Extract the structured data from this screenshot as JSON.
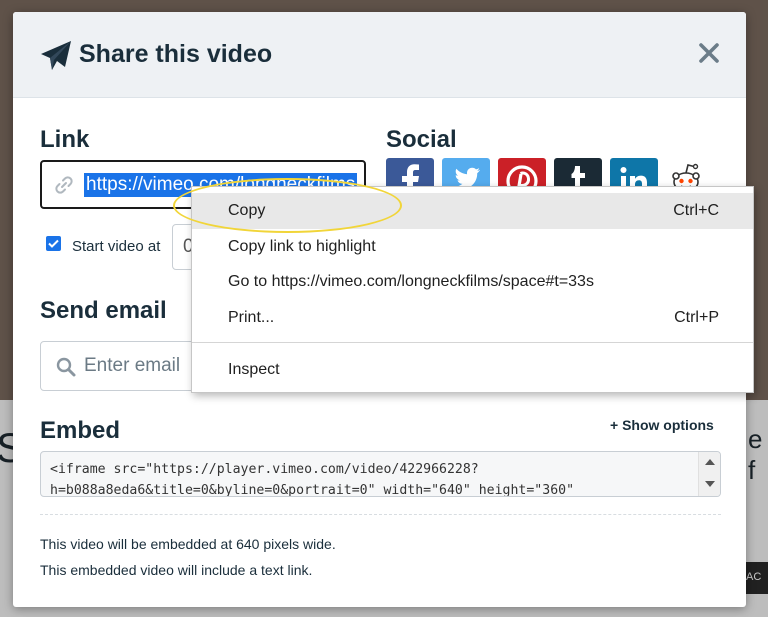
{
  "background": {
    "left_text": "S",
    "right_text": "e f",
    "right_badge": "AC"
  },
  "modal": {
    "title": "Share this video",
    "link": {
      "label": "Link",
      "url": "https://vimeo.com/longneckfilms"
    },
    "start_video": {
      "label": "Start video at",
      "checked": true,
      "value_partial": "0"
    },
    "social": {
      "label": "Social",
      "icons": [
        "facebook-icon",
        "twitter-icon",
        "pinterest-icon",
        "tumblr-icon",
        "linkedin-icon",
        "reddit-icon"
      ]
    },
    "send_email": {
      "label": "Send email",
      "placeholder": "Enter email"
    },
    "embed": {
      "label": "Embed",
      "show_options": "+ Show options",
      "code": "<iframe src=\"https://player.vimeo.com/video/422966228?\nh=b088a8eda6&title=0&byline=0&portrait=0\" width=\"640\" height=\"360\"",
      "note_width": "This video will be embedded at 640 pixels wide.",
      "note_link": "This embedded video will include a text link."
    }
  },
  "context_menu": {
    "items": [
      {
        "label": "Copy",
        "shortcut": "Ctrl+C"
      },
      {
        "label": "Copy link to highlight",
        "shortcut": ""
      },
      {
        "label": "Go to https://vimeo.com/longneckfilms/space#t=33s",
        "shortcut": ""
      },
      {
        "label": "Print...",
        "shortcut": "Ctrl+P"
      },
      {
        "label": "Inspect",
        "shortcut": ""
      }
    ]
  },
  "colors": {
    "facebook": "#3b5998",
    "twitter": "#55acee",
    "pinterest": "#cb2027",
    "tumblr": "#1b2a35",
    "linkedin": "#0e76a8",
    "reddit": "#ff4500",
    "highlight": "#f1d539",
    "selection": "#1a73e8"
  }
}
